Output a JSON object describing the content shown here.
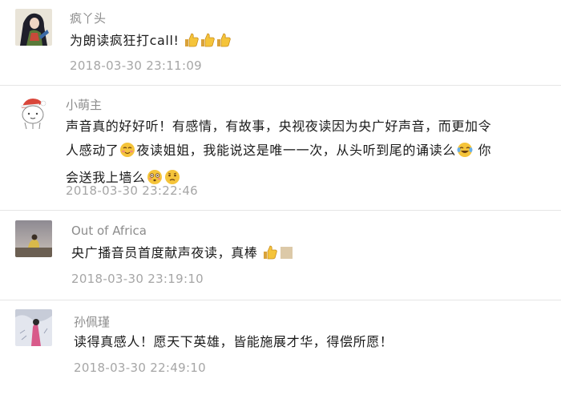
{
  "comments": [
    {
      "nickname": "疯丫头",
      "text": "为朗读疯狂打call!",
      "emoji_after": [
        "thumbs-up-icon",
        "thumbs-up-icon",
        "thumbs-up-icon"
      ],
      "time": "2018-03-30 23:11:09"
    },
    {
      "nickname": "小萌主",
      "text_line1": "声音真的好好听！有感情，有故事，央视夜读因为央广好声音，而更加令",
      "text_line2_a": "人感动了",
      "text_line2_b": "夜读姐姐，我能说这是唯一一次，从头听到尾的诵读么",
      "text_line2_c": "你",
      "text_line3": "会送我上墙么",
      "time": "2018-03-30 23:22:46"
    },
    {
      "nickname": "Out of Africa",
      "text": "央广播音员首度献声夜读，真棒",
      "time": "2018-03-30 23:19:10"
    },
    {
      "nickname": "孙佩瑾",
      "text": "读得真感人！愿天下英雄，皆能施展才华，得偿所愿！",
      "time": "2018-03-30 22:49:10"
    }
  ],
  "colors": {
    "nickname": "#8c8c8c",
    "text": "#1a1a1a",
    "timestamp": "#a6a6a6",
    "divider": "#e6e6e6",
    "emoji_yellow": "#f5c43a"
  }
}
